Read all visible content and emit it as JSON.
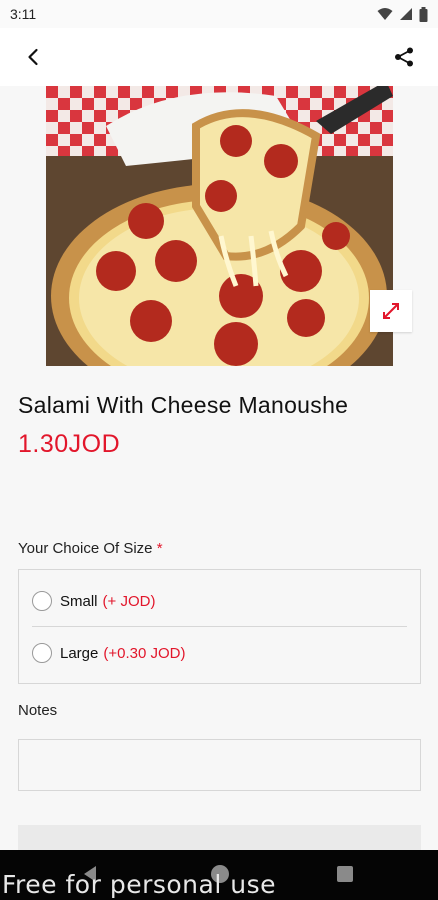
{
  "status_bar": {
    "time": "3:11"
  },
  "product": {
    "title": "Salami With Cheese Manoushe",
    "price": "1.30JOD"
  },
  "size_group": {
    "label": "Your Choice Of Size",
    "required_marker": "*",
    "options": [
      {
        "name": "Small",
        "extra": "(+ JOD)"
      },
      {
        "name": "Large",
        "extra": "(+0.30 JOD)"
      }
    ]
  },
  "notes": {
    "label": "Notes",
    "value": ""
  },
  "watermark": "Free for personal use",
  "colors": {
    "accent": "#e2162b",
    "background": "#f7f7f7",
    "navbar": "#050505"
  },
  "icons": [
    "back-arrow-icon",
    "share-icon",
    "expand-icon",
    "wifi-icon",
    "signal-icon",
    "battery-icon"
  ]
}
